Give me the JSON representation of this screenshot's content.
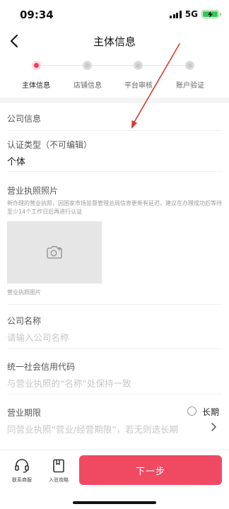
{
  "status_bar": {
    "time": "09:34",
    "network": "5G",
    "battery_icon": "battery-charging-icon"
  },
  "header": {
    "title": "主体信息",
    "back_icon": "back-arrow-icon"
  },
  "steps": [
    {
      "label": "主体信息",
      "active": true
    },
    {
      "label": "店铺信息",
      "active": false
    },
    {
      "label": "平台审核",
      "active": false
    },
    {
      "label": "账户验证",
      "active": false
    }
  ],
  "form": {
    "section_title": "公司信息",
    "cert_type": {
      "label": "认证类型（不可编辑）",
      "value": "个体"
    },
    "license": {
      "label": "营业执照照片",
      "note": "新办理的营业执照，因国家市场监督管理总局信息更新有延迟，建议在办理成功后等待至少14个工作日后再进行认证",
      "upload_icon": "camera-add-icon",
      "caption": "营业执照图片"
    },
    "company_name": {
      "label": "公司名称",
      "placeholder": "请输入公司名称"
    },
    "credit_code": {
      "label": "统一社会信用代码",
      "placeholder": "与营业执照的“名称”处保持一致"
    },
    "business_term": {
      "label": "营业期限",
      "option_label": "长期",
      "placeholder": "同营业执照“营业/经营期限”，若无则选长期"
    }
  },
  "bottom_bar": {
    "support_label": "联系商服",
    "support_icon": "headset-icon",
    "guide_label": "入驻攻略",
    "guide_icon": "guide-book-icon",
    "next_label": "下一步"
  },
  "colors": {
    "accent": "#f04a63",
    "annotation_arrow": "#d63a2f"
  }
}
